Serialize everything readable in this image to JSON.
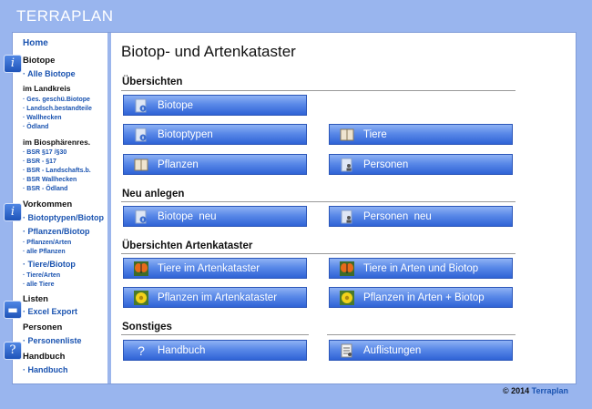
{
  "app": {
    "brand": "TERRAPLAN"
  },
  "sidebar": {
    "home": "Home",
    "biotope": {
      "heading": "Biotope",
      "all": "· Alle Biotope"
    },
    "landkreis": {
      "heading": "im Landkreis",
      "items": [
        "· Ges. geschü.Biotope",
        "· Landsch.bestandteile",
        "· Wallhecken",
        "· Ödland"
      ]
    },
    "biosphaere": {
      "heading": "im Biosphärenres.",
      "items": [
        "· BSR §17 /§30",
        "· BSR - §17",
        "· BSR - Landschafts.b.",
        "· BSR Wallhecken",
        "· BSR - Ödland"
      ]
    },
    "vorkommen": {
      "heading": "Vorkommen",
      "biotoptypen": "· Biotoptypen/Biotop",
      "pflanzen": "· Pflanzen/Biotop",
      "pflanzen_arten": "· Pflanzen/Arten",
      "alle_pflanzen": "· alle Pflanzen",
      "tiere": "· Tiere/Biotop",
      "tiere_arten": "· Tiere/Arten",
      "alle_tiere": "· alle Tiere"
    },
    "listen": {
      "heading": "Listen",
      "excel": "· Excel Export"
    },
    "personen": {
      "heading": "Personen",
      "liste": "· Personenliste"
    },
    "handbuch": {
      "heading": "Handbuch",
      "link": "· Handbuch"
    }
  },
  "main": {
    "title": "Biotop- und Artenkataster",
    "sections": {
      "uebersichten": "Übersichten",
      "neu": "Neu anlegen",
      "artenkataster": "Übersichten Artenkataster",
      "sonstiges": "Sonstiges"
    },
    "buttons": {
      "biotope": "Biotope",
      "biotoptypen": "Biotoptypen",
      "tiere": "Tiere",
      "pflanzen": "Pflanzen",
      "personen": "Personen",
      "biotope_neu": "Biotope  neu",
      "personen_neu": "Personen  neu",
      "tiere_kataster": "Tiere im Artenkataster",
      "tiere_arten_biotop": "Tiere in Arten und Biotop",
      "pflanzen_kataster": "Pflanzen im Artenkataster",
      "pflanzen_arten_biotop": "Pflanzen in Arten + Biotop",
      "handbuch": "Handbuch",
      "auflistungen": "Auflistungen"
    }
  },
  "footer": {
    "copyright": "© 2014 ",
    "link": "Terraplan"
  },
  "colors": {
    "background": "#99b5ee",
    "button": "#4a7fe4",
    "link": "#1a53b0"
  }
}
